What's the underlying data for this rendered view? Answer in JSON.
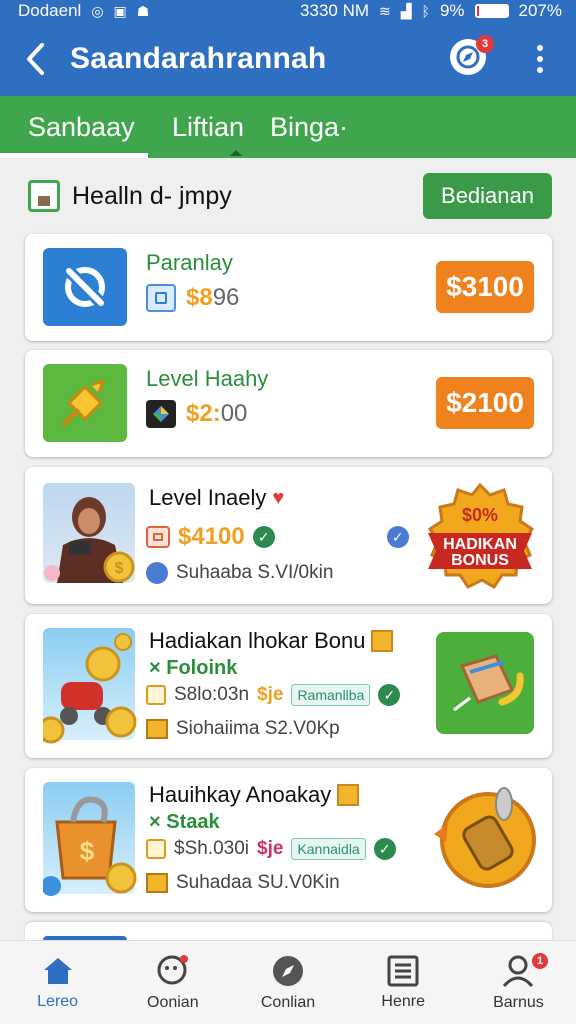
{
  "status_bar": {
    "carrier": "Dodaenl",
    "time": "3330 NM",
    "battery": "9%",
    "battery_level": 0.09,
    "extra": "207%",
    "icons": [
      "circle-icon",
      "message-icon",
      "game-icon",
      "wifi-icon",
      "signal-icon",
      "bluetooth-icon",
      "battery-icon"
    ]
  },
  "app_bar": {
    "title": "Saandarahrannah",
    "notification_count": "3"
  },
  "tabs": [
    "Sanbaay",
    "Liftian",
    "Binga·"
  ],
  "section": {
    "title": "Healln d- jmpy",
    "button": "Bedianan"
  },
  "cards": [
    {
      "name": "Paranlay",
      "price_prefix": "$8",
      "price_rest": "96",
      "button": "$3100",
      "thumb_bg": "#2d7fd4"
    },
    {
      "name": "Level Haahy",
      "price_prefix": "$2:",
      "price_rest": "00",
      "button": "$2100",
      "thumb_bg": "#5cb83e"
    },
    {
      "name": "Level Inaely",
      "price": "$4100",
      "meta": "Suhaaba S.VI/0kin",
      "badge_top": "$0%",
      "badge_line1": "HADIKAN",
      "badge_line2": "BONUS"
    },
    {
      "name": "Hadiakan lhokar Bonu",
      "sub": "× Foloink",
      "price": "S8lo:03n",
      "sale": "$je",
      "tag": "Ramanllba",
      "meta": "Siohaiima S2.V0Kp"
    },
    {
      "name": "Hauihkay Anoakay",
      "sub": "× Staak",
      "price": "$Sh.030i",
      "sale": "$je",
      "tag": "Kannaidla",
      "meta": "Suhadaa SU.V0Kin"
    }
  ],
  "bottom_nav": [
    {
      "label": "Lereo",
      "icon": "home-icon",
      "active": true
    },
    {
      "label": "Oonian",
      "icon": "chat-icon"
    },
    {
      "label": "Conlian",
      "icon": "compass-icon"
    },
    {
      "label": "Henre",
      "icon": "list-icon"
    },
    {
      "label": "Barnus",
      "icon": "profile-icon",
      "badge": "1"
    }
  ],
  "colors": {
    "app_bar": "#2f6fc1",
    "tabs": "#3fa64e",
    "price_button": "#f0821e",
    "gold": "#f0a020"
  }
}
